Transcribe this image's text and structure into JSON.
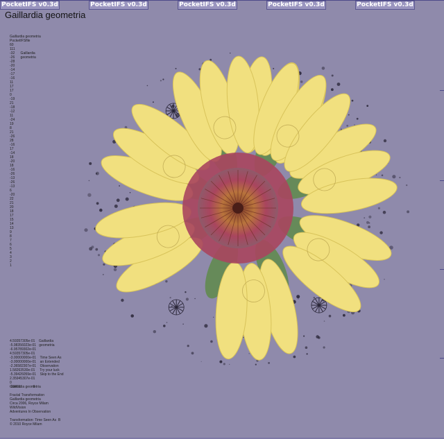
{
  "tabs": [
    "PocketIFS v0.3d",
    "PocketIFS v0.3d",
    "PocketIFS v0.3d",
    "PocketIFS v0.3d",
    "PocketIFS v0.3d"
  ],
  "title": "Gaillardia geometria",
  "side_header": "Gaillardia geometria\nPocketIFSfile\n60\n111\n-32      Gaillardia\n-26      geometria\n-28\n-20",
  "side_numbers": "-14\n-17\n-16\n11\n17\n17\n0\n-19\n21\n-18\n-12\n11\n-24\n19\n8\n21\n-26\n28\n-16\n17\n-14\n18\n-20\n18\n-16\n-26\n-13\n-26\n-13\n6\n-20\n22\n21\n20\n18\n17\n15\n14\n13\n9\n8\n7\n6\n5\n4\n3\n2\n1",
  "side_footer": "4.59357305e-01    Gaillardia\n-5.98356023e-01   geometria\n-6.95789302e-01\n4.59357305e-01\n-3.00000000e-01    Time Seen As\n-3.00000000e-01    an Extended\n-2.36582307e-01    Observation\n1.58263530e-01     Try your luck\n-5.39426059e-01    Skip to the End\n2.35945307e-01\n0\n-20e01             8",
  "caption": "Gaillardia geometria\n\nFractal Transformation\nGaillardia geometria\nCirca 2006, Royce Milam\nWildVision\nAdventures In Observation\n\nTransformation: Time Seen As  B\n© 2010 Royce Milam",
  "colors": {
    "background": "#8f8aab",
    "petal": "#f1e07f",
    "petal_edge": "#d8c35a",
    "center": "#a9455e",
    "disc": "#b8743c",
    "leaf": "#5f8a4a"
  }
}
